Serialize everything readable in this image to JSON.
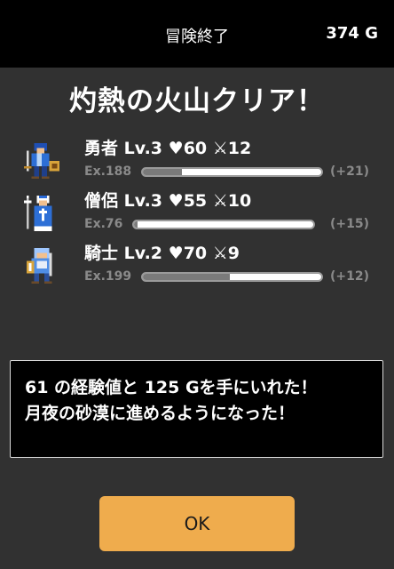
{
  "header": {
    "title": "冒険終了",
    "gold": "374 G"
  },
  "result_title": "灼熱の火山クリア！",
  "party": [
    {
      "name": "勇者",
      "level": "Lv.3",
      "hp": "♥60",
      "atk": "⚔12",
      "exp": "Ex.188",
      "gain": "(+21)",
      "exp_progress": 0.22,
      "icon": "hero-sprite-icon"
    },
    {
      "name": "僧侶",
      "level": "Lv.3",
      "hp": "♥55",
      "atk": "⚔10",
      "exp": "Ex.76",
      "gain": "(+15)",
      "exp_progress": 0.02,
      "icon": "priest-sprite-icon"
    },
    {
      "name": "騎士",
      "level": "Lv.2",
      "hp": "♥70",
      "atk": "⚔9",
      "exp": "Ex.199",
      "gain": "(+12)",
      "exp_progress": 0.49,
      "icon": "knight-sprite-icon"
    }
  ],
  "message": {
    "line1": "61 の経験値と 125 Gを手にいれた！",
    "line2": "月夜の砂漠に進めるようになった！"
  },
  "ok_label": "OK",
  "colors": {
    "ok_button": "#efac4d",
    "panel": "#313131",
    "header": "#000000"
  }
}
